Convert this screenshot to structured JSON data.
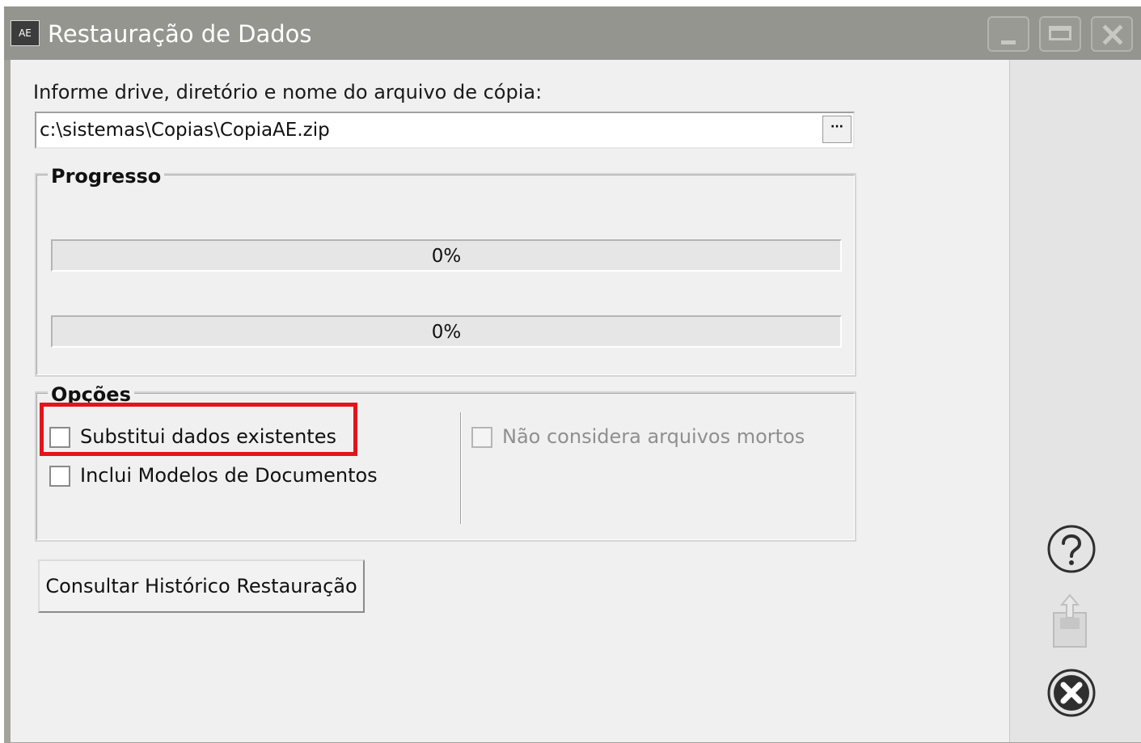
{
  "window": {
    "app_icon_text": "AE",
    "title": "Restauração de Dados",
    "controls": {
      "minimize_icon": "minimize-icon",
      "maximize_icon": "maximize-icon",
      "close_icon": "close-icon"
    }
  },
  "file": {
    "label": "Informe drive, diretório e nome do arquivo de cópia:",
    "value": "c:\\sistemas\\Copias\\CopiaAE.zip",
    "browse_label": "···"
  },
  "progress": {
    "title": "Progresso",
    "bars": [
      {
        "value": 0,
        "text": "0%"
      },
      {
        "value": 0,
        "text": "0%"
      }
    ]
  },
  "options": {
    "title": "Opções",
    "substitui_label": "Substitui dados existentes",
    "substitui_checked": false,
    "modelos_label": "Inclui Modelos de Documentos",
    "modelos_checked": false,
    "mortos_label": "Não considera arquivos mortos",
    "mortos_checked": false,
    "mortos_enabled": false,
    "highlight_color": "#e3141b"
  },
  "history_button_label": "Consultar Histórico Restauração",
  "side_icons": [
    "help-icon",
    "export-icon",
    "close-circle-icon"
  ]
}
